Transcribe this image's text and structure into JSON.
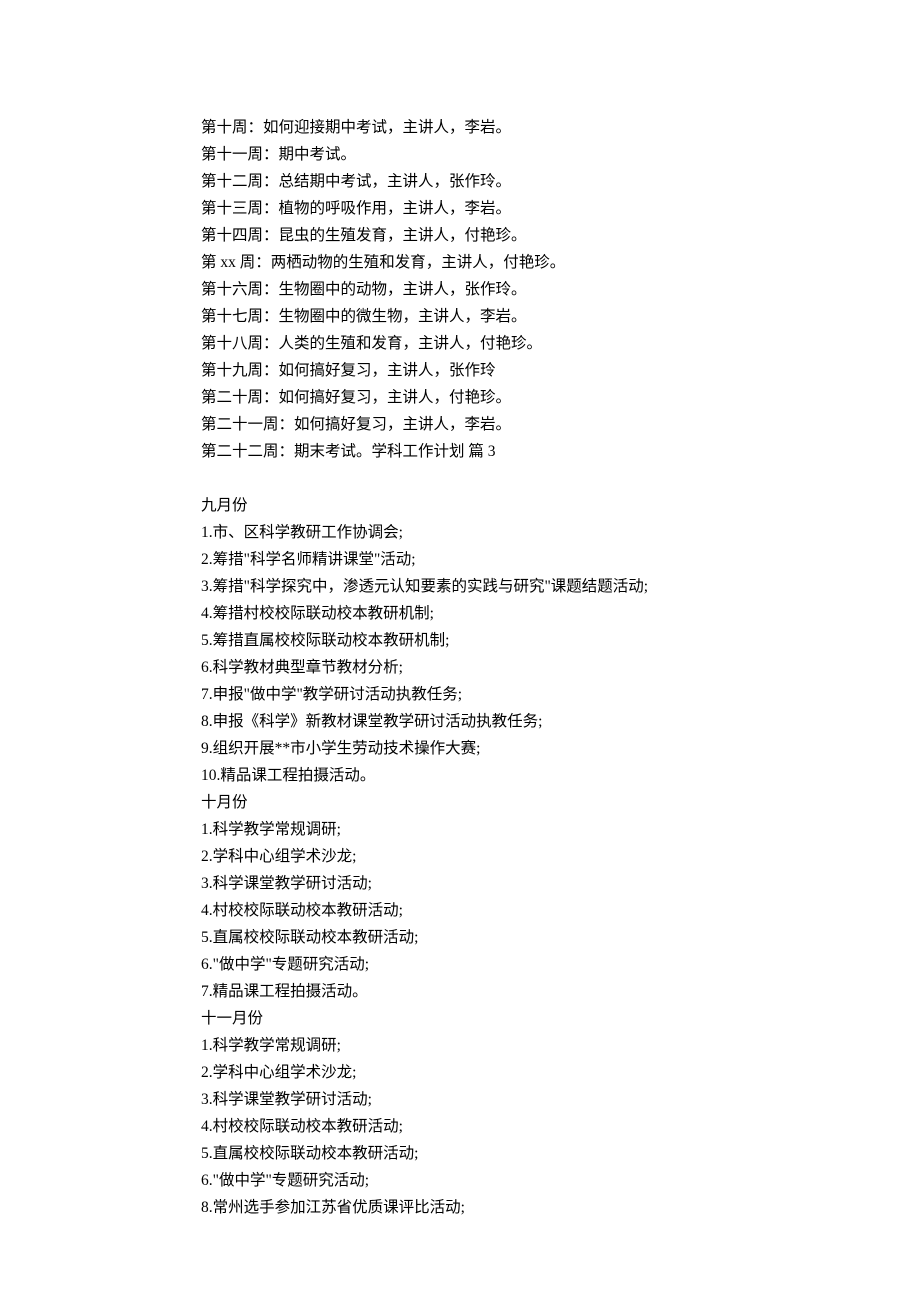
{
  "section1": {
    "lines": [
      "第十周：如何迎接期中考试，主讲人，李岩。",
      "第十一周：期中考试。",
      "第十二周：总结期中考试，主讲人，张作玲。",
      "第十三周：植物的呼吸作用，主讲人，李岩。",
      "第十四周：昆虫的生殖发育，主讲人，付艳珍。",
      "第 xx 周：两栖动物的生殖和发育，主讲人，付艳珍。",
      "第十六周：生物圈中的动物，主讲人，张作玲。",
      "第十七周：生物圈中的微生物，主讲人，李岩。",
      "第十八周：人类的生殖和发育，主讲人，付艳珍。",
      "第十九周：如何搞好复习，主讲人，张作玲",
      "第二十周：如何搞好复习，主讲人，付艳珍。",
      "第二十一周：如何搞好复习，主讲人，李岩。",
      "第二十二周：期末考试。学科工作计划 篇 3"
    ]
  },
  "section2": {
    "heading": "九月份",
    "items": [
      "1.市、区科学教研工作协调会;",
      "2.筹措\"科学名师精讲课堂\"活动;",
      "3.筹措\"科学探究中，渗透元认知要素的实践与研究\"课题结题活动;",
      "4.筹措村校校际联动校本教研机制;",
      "5.筹措直属校校际联动校本教研机制;",
      "6.科学教材典型章节教材分析;",
      "7.申报\"做中学\"教学研讨活动执教任务;",
      "8.申报《科学》新教材课堂教学研讨活动执教任务;",
      "9.组织开展**市小学生劳动技术操作大赛;",
      "10.精品课工程拍摄活动。"
    ]
  },
  "section3": {
    "heading": "十月份",
    "items": [
      "1.科学教学常规调研;",
      "2.学科中心组学术沙龙;",
      "3.科学课堂教学研讨活动;",
      "4.村校校际联动校本教研活动;",
      "5.直属校校际联动校本教研活动;",
      "6.\"做中学\"专题研究活动;",
      "7.精品课工程拍摄活动。"
    ]
  },
  "section4": {
    "heading": "十一月份",
    "items": [
      "1.科学教学常规调研;",
      "2.学科中心组学术沙龙;",
      "3.科学课堂教学研讨活动;",
      "4.村校校际联动校本教研活动;",
      "5.直属校校际联动校本教研活动;",
      "6.\"做中学\"专题研究活动;",
      "8.常州选手参加江苏省优质课评比活动;"
    ]
  }
}
